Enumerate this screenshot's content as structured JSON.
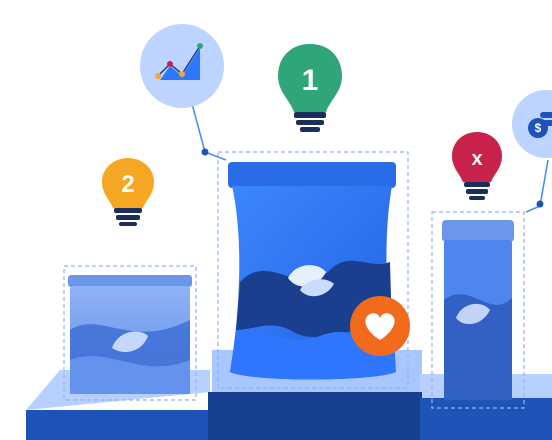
{
  "bulbs": [
    {
      "label": "1",
      "color": "#2fa67a"
    },
    {
      "label": "2",
      "color": "#f5a623"
    },
    {
      "label": "x",
      "color": "#c8224a"
    }
  ],
  "icons": {
    "chart": "line-chart-icon",
    "money": "money-coins-icon",
    "heart": "heart-icon",
    "leaf": "leaf-icon"
  },
  "colors": {
    "podium_light": "#a8c6ff",
    "podium_dark": "#1e54b7",
    "package_blue": "#2f76ff",
    "package_navy": "#1b3f8f",
    "badge_orange": "#f26a1b",
    "bubble": "#bcd4ff"
  }
}
